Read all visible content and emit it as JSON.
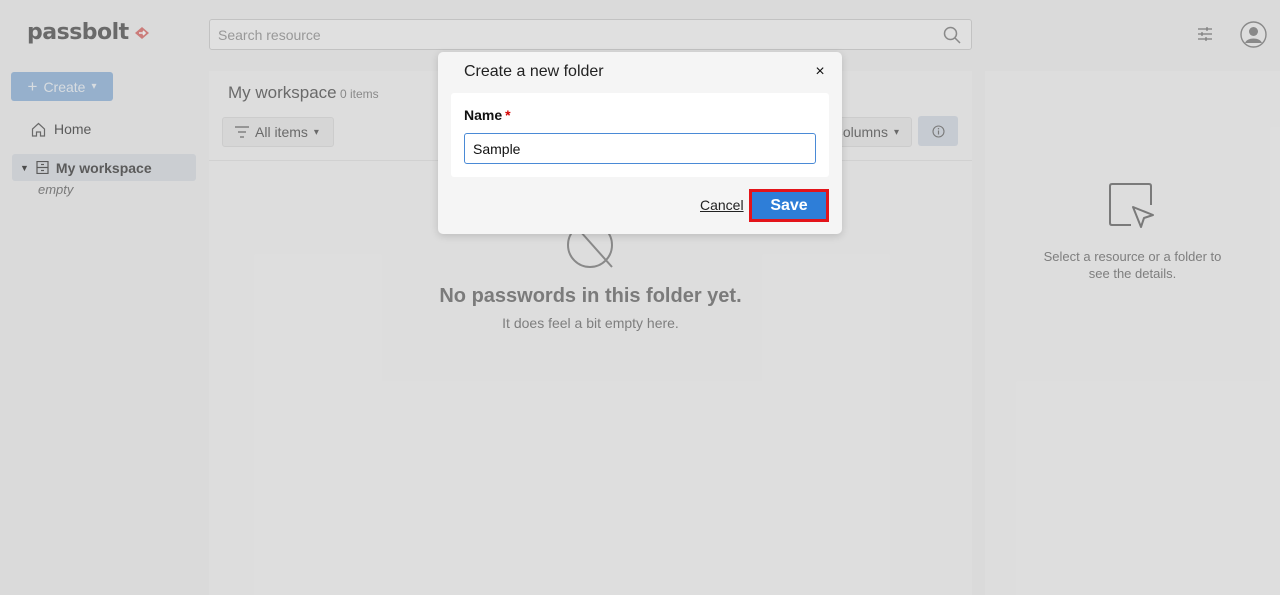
{
  "header": {
    "logo_text": "passbolt",
    "search": {
      "placeholder": "Search resource"
    }
  },
  "sidebar": {
    "create_label": "Create",
    "home_label": "Home",
    "workspace_label": "My workspace",
    "workspace_empty": "empty"
  },
  "main": {
    "title": "My workspace",
    "count": "0 items",
    "filter_label": "All items",
    "columns_label": "Columns",
    "empty_title": "No passwords in this folder yet.",
    "empty_subtitle": "It does feel a bit empty here."
  },
  "details_panel": {
    "text": "Select a resource or a folder to see the details."
  },
  "dialog": {
    "title": "Create a new folder",
    "close_symbol": "×",
    "name_label": "Name",
    "required_mark": "*",
    "name_value": "Sample",
    "cancel_label": "Cancel",
    "save_label": "Save"
  },
  "colors": {
    "accent": "#2e7ed8",
    "highlight_border": "#e3141a",
    "required": "#d40101",
    "logo_mark": "#e05a55"
  }
}
